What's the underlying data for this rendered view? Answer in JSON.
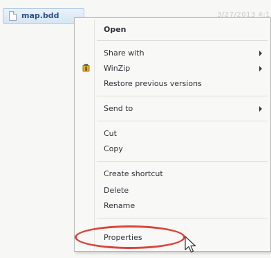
{
  "explorer": {
    "file_name": "map.bdd",
    "faint_header": "3/27/2013 4:1"
  },
  "context_menu": {
    "items": {
      "open": "Open",
      "share_with": "Share with",
      "winzip": "WinZip",
      "restore_previous_versions": "Restore previous versions",
      "send_to": "Send to",
      "cut": "Cut",
      "copy": "Copy",
      "create_shortcut": "Create shortcut",
      "delete": "Delete",
      "rename": "Rename",
      "properties": "Properties"
    },
    "submenu_items": [
      "share_with",
      "winzip",
      "send_to"
    ],
    "highlighted_item": "properties"
  },
  "icons": {
    "file": "document-icon",
    "winzip": "winzip-vise-icon",
    "cursor": "mouse-pointer-icon",
    "submenu": "chevron-right-icon"
  },
  "colors": {
    "highlight_oval": "#d9453c",
    "selection_fill": "#d6e6f6",
    "file_name_text": "#2b4e86"
  }
}
